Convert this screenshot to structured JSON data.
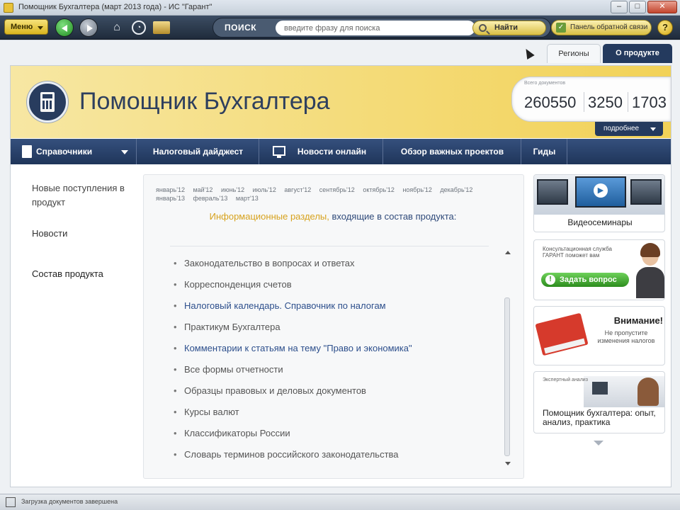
{
  "window": {
    "title": "Помощник Бухгалтера (март 2013 года) - ИС \"Гарант\"",
    "min": "–",
    "max": "□",
    "close": "✕"
  },
  "toolbar": {
    "menu_label": "Меню",
    "search_label": "ПОИСК",
    "search_placeholder": "введите фразу для поиска",
    "find_label": "Найти",
    "feedback_label": "Панель обратной связи",
    "help_label": "?"
  },
  "tabs": {
    "regions": "Регионы",
    "about": "О продукте"
  },
  "header": {
    "title": "Помощник Бухгалтера",
    "counter_caption": "Всего документов",
    "counters": [
      "260550",
      "3250",
      "1703"
    ],
    "more_label": "подробнее"
  },
  "nav": {
    "reference": "Справочники",
    "tax_digest": "Налоговый дайджест",
    "news_online": "Новости онлайн",
    "review": "Обзор важных проектов",
    "guides": "Гиды"
  },
  "sidebar": {
    "new_arrivals": "Новые поступления в продукт",
    "news": "Новости",
    "composition": "Состав продукта"
  },
  "content": {
    "versions_line1": [
      "январь'12",
      "май'12",
      "июнь'12",
      "июль'12",
      "август'12",
      "сентябрь'12",
      "октябрь'12",
      "ноябрь'12",
      "декабрь'12"
    ],
    "versions_line2": [
      "январь'13",
      "февраль'13",
      "март'13"
    ],
    "heading_accent": "Информационные разделы,",
    "heading_rest": "входящие в состав продукта:",
    "items": [
      "Законодательство в вопросах и ответах",
      "Корреспонденция счетов",
      "Налоговый календарь. Справочник по налогам",
      "Практикум Бухгалтера",
      "Комментарии к статьям на тему \"Право и экономика\"",
      "Все формы отчетности",
      "Образцы правовых и деловых документов",
      "Курсы валют",
      "Классификаторы России",
      "Словарь терминов российского законодательства"
    ]
  },
  "promos": {
    "video": "Видеосеминары",
    "consult_text": "Консультационная служба ГАРАНТ поможет вам",
    "ask_button": "Задать вопрос",
    "attention_title": "Внимание!",
    "attention_text": "Не пропустите изменения налогов",
    "office_small": "Экспертный анализ",
    "office_caption": "Помощник бухгалтера: опыт, анализ, практика"
  },
  "status": {
    "text": "Загрузка документов завершена"
  },
  "colors": {
    "navy": "#243a5e",
    "gold": "#f2d258",
    "link": "#2d4f8c"
  }
}
